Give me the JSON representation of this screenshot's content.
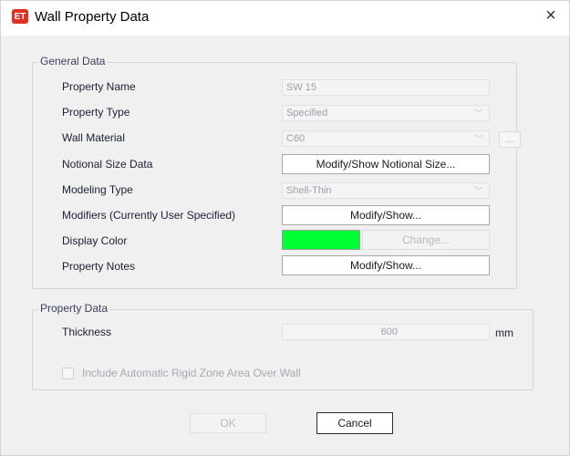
{
  "window": {
    "title": "Wall Property Data",
    "app_icon_text": "ET",
    "close_glyph": "×"
  },
  "general": {
    "group_title": "General Data",
    "property_name": {
      "label": "Property Name",
      "value": "SW 15"
    },
    "property_type": {
      "label": "Property Type",
      "value": "Specified"
    },
    "wall_material": {
      "label": "Wall Material",
      "value": "C60",
      "more_button": "..."
    },
    "notional_size": {
      "label": "Notional Size Data",
      "button": "Modify/Show Notional Size..."
    },
    "modeling_type": {
      "label": "Modeling Type",
      "value": "Shell-Thin"
    },
    "modifiers": {
      "label": "Modifiers (Currently User Specified)",
      "button": "Modify/Show..."
    },
    "display_color": {
      "label": "Display Color",
      "color": "#00ff33",
      "button": "Change..."
    },
    "property_notes": {
      "label": "Property Notes",
      "button": "Modify/Show..."
    }
  },
  "property_data": {
    "group_title": "Property Data",
    "thickness": {
      "label": "Thickness",
      "value": "600",
      "unit": "mm"
    },
    "rigid_zone_checkbox": {
      "label": "Include Automatic Rigid Zone Area Over Wall",
      "checked": false
    }
  },
  "footer": {
    "ok_label": "OK",
    "cancel_label": "Cancel"
  }
}
